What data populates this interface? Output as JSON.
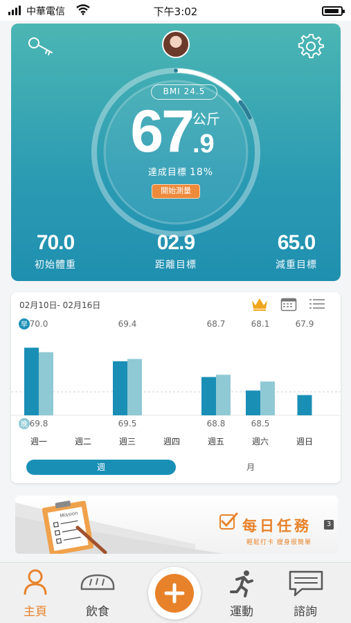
{
  "status_bar": {
    "carrier": "中華電信",
    "time": "下午3:02"
  },
  "hero": {
    "bmi_label": "BMI",
    "bmi_value": "24.5",
    "weight_int": "67",
    "weight_dec": ".9",
    "weight_unit": "公斤",
    "goal_label": "達成目標",
    "goal_pct": "18%",
    "goal_progress": 0.18,
    "start_button": "開始測量",
    "stats": [
      {
        "value": "70.0",
        "label": "初始體重"
      },
      {
        "value": "02.9",
        "label": "距離目標"
      },
      {
        "value": "65.0",
        "label": "減重目標"
      }
    ],
    "colors": {
      "accent": "#ee8a3b",
      "card_top": "#4cb6b3",
      "card_bottom": "#1f8fb0"
    },
    "icons": {
      "left": "key-icon",
      "right": "gear-icon",
      "center": "avatar"
    }
  },
  "chart": {
    "date_range": "02月10日- 02月16日",
    "morning_marker": "早",
    "evening_marker": "晚",
    "toggle_week": "週",
    "toggle_month": "月",
    "icons": [
      "crown-icon",
      "calendar-icon",
      "list-icon"
    ]
  },
  "chart_data": {
    "type": "bar",
    "categories": [
      "週一",
      "週二",
      "週三",
      "週四",
      "週五",
      "週六",
      "週日"
    ],
    "series": [
      {
        "name": "早",
        "values": [
          70.0,
          null,
          69.4,
          null,
          68.7,
          68.1,
          67.9
        ]
      },
      {
        "name": "晚",
        "values": [
          69.8,
          null,
          69.5,
          null,
          68.8,
          68.5,
          null
        ]
      }
    ],
    "top_labels": [
      "70.0",
      "",
      "69.4",
      "",
      "68.7",
      "68.1",
      "67.9"
    ],
    "bottom_labels": [
      "69.8",
      "",
      "69.5",
      "",
      "68.8",
      "68.5",
      ""
    ],
    "colors": {
      "morning": "#1a8fb6",
      "evening": "#8fc9d4"
    },
    "ylim": [
      67.0,
      70.5
    ],
    "grid": false
  },
  "mission": {
    "title": "每日任務",
    "badge": "3",
    "subtitle": "輕鬆打卡 瘦身很簡單",
    "clipboard_text": "Mission"
  },
  "bottom_nav": {
    "items": [
      {
        "label": "主頁",
        "icon": "person-icon"
      },
      {
        "label": "飲食",
        "icon": "bread-icon"
      },
      {
        "label": "",
        "icon": "plus-icon"
      },
      {
        "label": "運動",
        "icon": "running-icon"
      },
      {
        "label": "諮詢",
        "icon": "chat-icon"
      }
    ]
  }
}
